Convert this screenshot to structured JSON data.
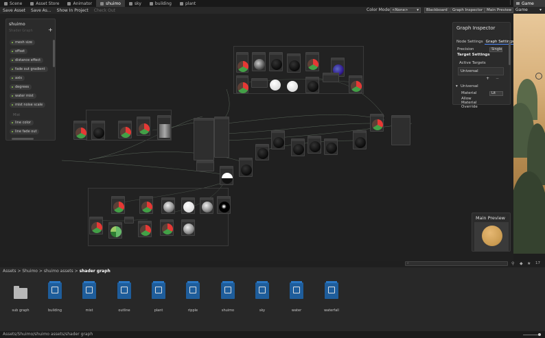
{
  "tabs": [
    {
      "label": "Scene",
      "icon": "scene-icon"
    },
    {
      "label": "Asset Store",
      "icon": "store-icon"
    },
    {
      "label": "Animator",
      "icon": "animator-icon"
    },
    {
      "label": "shuimo",
      "icon": "shadergraph-icon",
      "active": true
    },
    {
      "label": "sky",
      "icon": "shadergraph-icon"
    },
    {
      "label": "building",
      "icon": "shadergraph-icon"
    },
    {
      "label": "plant",
      "icon": "shadergraph-icon"
    }
  ],
  "game_tab": {
    "label": "Game"
  },
  "toolbar": {
    "save_asset": "Save Asset",
    "save_as": "Save As...",
    "show_in_project": "Show In Project",
    "check_out": "Check Out",
    "color_mode_label": "Color Mode",
    "color_mode_value": "<None>",
    "blackboard_btn": "Blackboard",
    "inspector_btn": "Graph Inspector",
    "preview_btn": "Main Preview"
  },
  "game_toolbar": {
    "display": "Game"
  },
  "blackboard": {
    "title": "shuimo",
    "subtitle": "Shader Graph",
    "properties": [
      "mesh size",
      "offset",
      "distance effect",
      "fade out gradient",
      "axis",
      "degrees",
      "water mist",
      "mist noise scale"
    ],
    "category": "Mist",
    "properties2": [
      "line color",
      "line fade out"
    ]
  },
  "inspector": {
    "title": "Graph Inspector",
    "tab_node": "Node Settings",
    "tab_graph": "Graph Settings",
    "precision_label": "Precision",
    "precision_value": "Single",
    "target_settings": "Target Settings",
    "active_targets": "Active Targets",
    "target_item": "Universal",
    "plus": "+",
    "minus": "−",
    "section": "Universal",
    "material_label": "Material",
    "material_value": "Lit",
    "allow_override": "Allow Material Override"
  },
  "main_preview": {
    "title": "Main Preview"
  },
  "project": {
    "search_placeholder": "",
    "count": "17",
    "breadcrumb": [
      "Assets",
      "Shuimo",
      "shuimo assets",
      "shader graph"
    ],
    "assets": [
      {
        "name": "sub graph",
        "type": "folder"
      },
      {
        "name": "building",
        "type": "shadergraph"
      },
      {
        "name": "mist",
        "type": "shadergraph"
      },
      {
        "name": "outline",
        "type": "shadergraph"
      },
      {
        "name": "plant",
        "type": "shadergraph"
      },
      {
        "name": "ripple",
        "type": "shadergraph"
      },
      {
        "name": "shuimo",
        "type": "shadergraph"
      },
      {
        "name": "sky",
        "type": "shadergraph"
      },
      {
        "name": "water",
        "type": "shadergraph"
      },
      {
        "name": "waterfall",
        "type": "shadergraph"
      }
    ],
    "status_path": "Assets/Shuimo/shuimo assets/shader graph"
  },
  "colors": {
    "accent": "#4f8cff",
    "shadergraph": "#1e5d9b",
    "panel": "#2b2b2b"
  }
}
